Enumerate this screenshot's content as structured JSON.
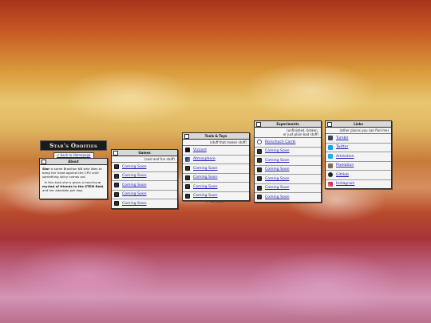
{
  "logo": {
    "text": "Star's Oddities"
  },
  "back_link": {
    "label": "< back to Homepage"
  },
  "about": {
    "title": "About",
    "para1_name": "Star",
    "para1_text": " is some Brazilian NB who likes to bang her head against the CPU until something shiny comes out.",
    "para2_text": "In this task she is given a hand by ",
    "para2_bold": "a myriad of friends in the STEM field",
    "para2_tail": ", and her adorable pet dog."
  },
  "games": {
    "title": "Games",
    "subtitle": "(cool and fun stuff)",
    "items": [
      {
        "label": "Coming Soon",
        "icon": "placeholder-icon"
      },
      {
        "label": "Coming Soon",
        "icon": "placeholder-icon"
      },
      {
        "label": "Coming Soon",
        "icon": "placeholder-icon"
      },
      {
        "label": "Coming Soon",
        "icon": "placeholder-icon"
      },
      {
        "label": "Coming Soon",
        "icon": "placeholder-icon"
      }
    ]
  },
  "tools": {
    "title": "Tools & Toys",
    "subtitle": "(stuff that makes stuff)",
    "items": [
      {
        "label": "Vizzard",
        "icon": "vizzard-icon"
      },
      {
        "label": "Atmosphere",
        "icon": "atmosphere-icon"
      },
      {
        "label": "Coming Soon",
        "icon": "placeholder-icon"
      },
      {
        "label": "Coming Soon",
        "icon": "placeholder-icon"
      },
      {
        "label": "Coming Soon",
        "icon": "placeholder-icon"
      },
      {
        "label": "Coming Soon",
        "icon": "placeholder-icon"
      }
    ]
  },
  "experiments": {
    "title": "Experiments",
    "subtitle_line1": "(unfinished, broken,",
    "subtitle_line2": "or just plain bad stuff)",
    "items": [
      {
        "label": "Rorschach Cards",
        "icon": "rorschach-icon"
      },
      {
        "label": "Coming Soon",
        "icon": "placeholder-icon"
      },
      {
        "label": "Coming Soon",
        "icon": "placeholder-icon"
      },
      {
        "label": "Coming Soon",
        "icon": "placeholder-icon"
      },
      {
        "label": "Coming Soon",
        "icon": "placeholder-icon"
      },
      {
        "label": "Coming Soon",
        "icon": "placeholder-icon"
      },
      {
        "label": "Coming Soon",
        "icon": "placeholder-icon"
      }
    ]
  },
  "links": {
    "title": "Links",
    "subtitle": "(other places you can find me)",
    "items": [
      {
        "label": "Tumblr",
        "icon": "tumblr-icon"
      },
      {
        "label": "Twitter",
        "icon": "twitter-icon"
      },
      {
        "label": "Artstation",
        "icon": "artstation-icon"
      },
      {
        "label": "Pixelation",
        "icon": "pixelation-icon"
      },
      {
        "label": "GitHub",
        "icon": "github-icon"
      },
      {
        "label": "Instagram",
        "icon": "instagram-icon"
      }
    ]
  },
  "credit": "© Star 2020",
  "colors": {
    "link": "#1a1ab8",
    "window_bg": "#f4f4f4",
    "title_bar": "#d8d8d8",
    "border": "#2a2a2a"
  }
}
